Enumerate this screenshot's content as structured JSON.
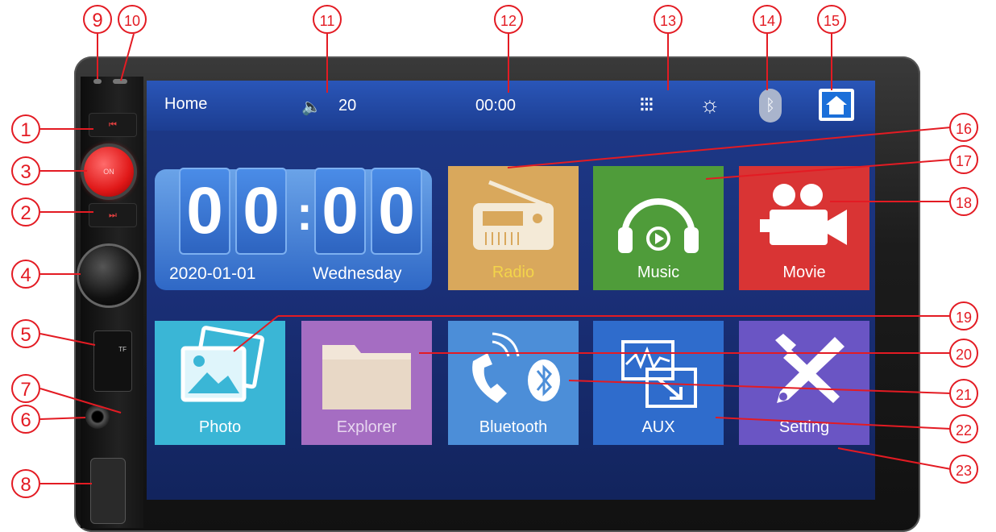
{
  "status_bar": {
    "home_label": "Home",
    "volume_value": "20",
    "time": "00:00"
  },
  "clock_widget": {
    "hour": [
      "0",
      "0"
    ],
    "minute": [
      "0",
      "0"
    ],
    "separator": ":",
    "date": "2020-01-01",
    "weekday": "Wednesday"
  },
  "apps": [
    {
      "label": "Radio",
      "color": "#d9a85c"
    },
    {
      "label": "Music",
      "color": "#4f9c3a"
    },
    {
      "label": "Movie",
      "color": "#d93434"
    },
    {
      "label": "Photo",
      "color": "#3ab6d6"
    },
    {
      "label": "Explorer",
      "color": "#a56dc2"
    },
    {
      "label": "Bluetooth",
      "color": "#4c8ed8"
    },
    {
      "label": "AUX",
      "color": "#2f6ccc"
    },
    {
      "label": "Setting",
      "color": "#6a55c4"
    }
  ],
  "hardware": {
    "power_label": "ON",
    "tf_label": "TF"
  },
  "callouts": [
    "1",
    "2",
    "3",
    "4",
    "5",
    "6",
    "7",
    "8",
    "9",
    "10",
    "11",
    "12",
    "13",
    "14",
    "15",
    "16",
    "17",
    "18",
    "19",
    "20",
    "21",
    "22",
    "23"
  ],
  "accent_color": "#e31b23"
}
